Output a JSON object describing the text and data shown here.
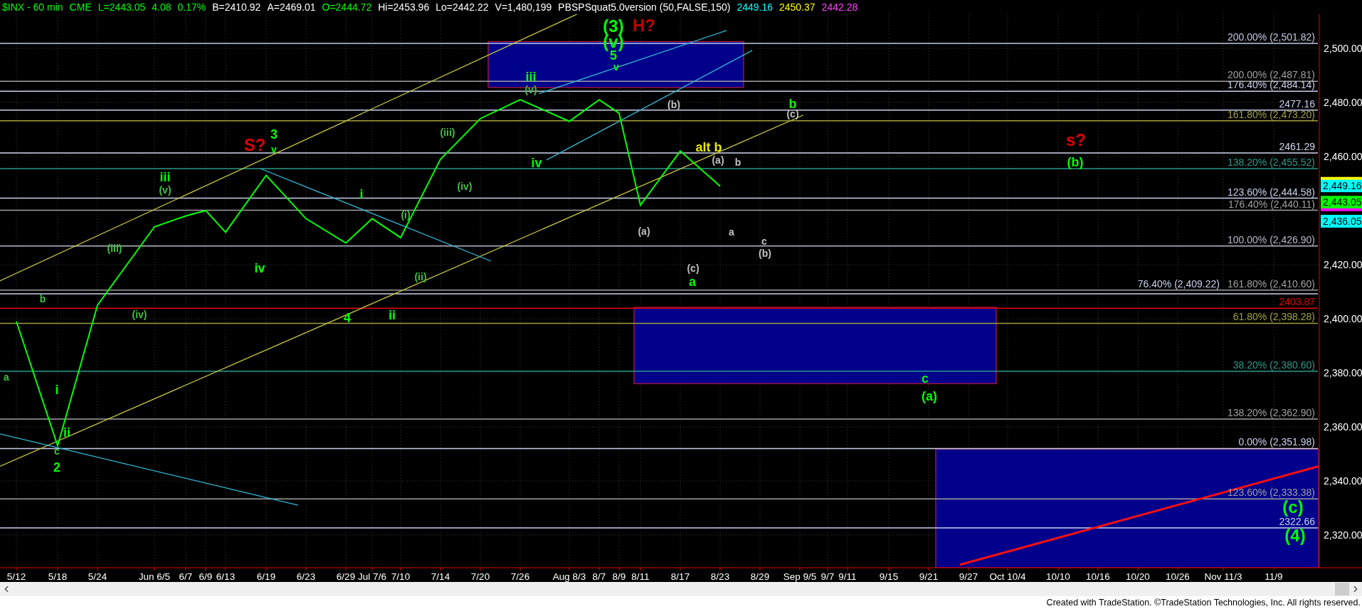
{
  "header": [
    {
      "text": "$INX - 60 min",
      "color": "#00ff00"
    },
    {
      "text": "CME",
      "color": "#00ff00"
    },
    {
      "text": "L=2443.05",
      "color": "#00ff00"
    },
    {
      "text": "4.08",
      "color": "#00ff00"
    },
    {
      "text": "0.17%",
      "color": "#00ff00"
    },
    {
      "text": "B=2410.92",
      "color": "#ffffff"
    },
    {
      "text": "A=2469.01",
      "color": "#ffffff"
    },
    {
      "text": "O=2444.72",
      "color": "#00ff00"
    },
    {
      "text": "Hi=2453.96",
      "color": "#ffffff"
    },
    {
      "text": "Lo=2442.22",
      "color": "#ffffff"
    },
    {
      "text": "V=1,480,199",
      "color": "#ffffff"
    },
    {
      "text": "PBSPSquat5.0version (50,FALSE,150)",
      "color": "#ffffff"
    },
    {
      "text": "2449.16",
      "color": "#00ffff"
    },
    {
      "text": "2450.37",
      "color": "#ffff00"
    },
    {
      "text": "2442.28",
      "color": "#ff40ff"
    }
  ],
  "chart": {
    "chart_data": {
      "type": "line",
      "categories": [
        "5/12",
        "5/18",
        "5/24",
        "Jun 6/5",
        "6/7",
        "6/9",
        "6/13",
        "6/19",
        "6/23",
        "6/29",
        "Jul 7/6",
        "7/10",
        "7/14",
        "7/20",
        "7/26",
        "Aug 8/3",
        "8/7",
        "8/9",
        "8/11",
        "8/17",
        "8/23",
        "8/29",
        "Sep 9/5",
        "9/7",
        "9/11",
        "9/15",
        "9/21",
        "9/27",
        "Oct 10/4",
        "10/10",
        "10/16",
        "10/20",
        "10/26",
        "Nov 11/3",
        "11/9"
      ],
      "series": [
        {
          "color": "#00ff00",
          "values": [
            2399,
            2353,
            2405,
            2434,
            2438,
            2440,
            2432,
            2453,
            2437,
            2428,
            2437,
            2430,
            2459,
            2474,
            2481,
            2473,
            2481,
            2476,
            2442,
            2462,
            2449,
            null,
            null,
            null,
            null,
            null,
            null,
            null,
            null,
            null,
            null,
            null,
            null,
            null,
            null
          ]
        }
      ],
      "ylim": [
        2307.9,
        2512.6
      ],
      "grid": true,
      "yticks": [
        {
          "value": 2500,
          "label": "2,500.00"
        },
        {
          "value": 2480,
          "label": "2,480.00"
        },
        {
          "value": 2460,
          "label": "2,460.00"
        },
        {
          "value": 2420,
          "label": "2,420.00"
        },
        {
          "value": 2400,
          "label": "2,400.00"
        },
        {
          "value": 2380,
          "label": "2,380.00"
        },
        {
          "value": 2360,
          "label": "2,360.00"
        },
        {
          "value": 2340,
          "label": "2,340.00"
        },
        {
          "value": 2320,
          "label": "2,320.00"
        }
      ]
    },
    "levels": [
      {
        "label": "200.00% (2,501.82)",
        "color": "#c0cae6"
      },
      {
        "label": "200.00% (2,487.81)",
        "color": "#a0a0a0"
      },
      {
        "label": "176.40% (2,484.14)",
        "color": "#c8d0ec"
      },
      {
        "label": "2477.16",
        "color": "#c8d0ec"
      },
      {
        "label": "161.80% (2,473.20)",
        "color": "#a0a040"
      },
      {
        "label": "2461.29",
        "color": "#d0d8f0"
      },
      {
        "label": "138.20% (2,455.52)",
        "color": "#2a9a86"
      },
      {
        "label": "123.60% (2,444.58)",
        "color": "#c8d0ec"
      },
      {
        "label": "176.40% (2,440.11)",
        "color": "#a0a0a0"
      },
      {
        "label": "100.00% (2,426.90)",
        "color": "#b8b8c8"
      },
      {
        "label": "76.40% (2,409.22)",
        "color": "#c8d0ec"
      },
      {
        "label": "161.80% (2,410.60)",
        "color": "#a0a0a0"
      },
      {
        "label": "2403.87",
        "color": "#e00000"
      },
      {
        "label": "61.80% (2,398.28)",
        "color": "#a0a040"
      },
      {
        "label": "38.20% (2,380.60)",
        "color": "#2a9a86"
      },
      {
        "label": "138.20% (2,362.90)",
        "color": "#a0a0a0"
      },
      {
        "label": "0.00% (2,351.98)",
        "color": "#c8d0ec"
      },
      {
        "label": "123.60% (2,333.38)",
        "color": "#a0a0a0"
      },
      {
        "label": "2322.66",
        "color": "#c8d0ec"
      }
    ],
    "wave_labels": [
      {
        "text": "(3)",
        "color": "#00ff00"
      },
      {
        "text": "(v)",
        "color": "#00ff00"
      },
      {
        "text": "H?",
        "color": "#c00000"
      },
      {
        "text": "5",
        "color": "#00ff00"
      },
      {
        "text": "v",
        "color": "#00ff00"
      },
      {
        "text": "iii",
        "color": "#00ff00"
      },
      {
        "text": "(v)",
        "color": "#40c040"
      },
      {
        "text": "(b)",
        "color": "#c0c0c0"
      },
      {
        "text": "b",
        "color": "#00ff00"
      },
      {
        "text": "(c)",
        "color": "#c0c0c0"
      },
      {
        "text": "s?",
        "color": "#e00000"
      },
      {
        "text": "(b)",
        "color": "#00ff00"
      },
      {
        "text": "S?",
        "color": "#e00000"
      },
      {
        "text": "3",
        "color": "#00ff00"
      },
      {
        "text": "v",
        "color": "#00ff00"
      },
      {
        "text": "iii",
        "color": "#00ff00"
      },
      {
        "text": "(v)",
        "color": "#40c040"
      },
      {
        "text": "(iii)",
        "color": "#40c040"
      },
      {
        "text": "iv",
        "color": "#00ff00"
      },
      {
        "text": "(iv)",
        "color": "#40c040"
      },
      {
        "text": "alt b",
        "color": "#e8e800"
      },
      {
        "text": "(a)",
        "color": "#c0c0c0"
      },
      {
        "text": "b",
        "color": "#c0c0c0"
      },
      {
        "text": "i",
        "color": "#00ff00"
      },
      {
        "text": "(i)",
        "color": "#40c040"
      },
      {
        "text": "(iii)",
        "color": "#40c040"
      },
      {
        "text": "iv",
        "color": "#00ff00"
      },
      {
        "text": "(a)",
        "color": "#c0c0c0"
      },
      {
        "text": "a",
        "color": "#c0c0c0"
      },
      {
        "text": "c",
        "color": "#c0c0c0"
      },
      {
        "text": "(b)",
        "color": "#c0c0c0"
      },
      {
        "text": "(ii)",
        "color": "#40c040"
      },
      {
        "text": "(c)",
        "color": "#c0c0c0"
      },
      {
        "text": "a",
        "color": "#00ff00"
      },
      {
        "text": "b",
        "color": "#40c040"
      },
      {
        "text": "(iv)",
        "color": "#40c040"
      },
      {
        "text": "4",
        "color": "#00ff00"
      },
      {
        "text": "ii",
        "color": "#00ff00"
      },
      {
        "text": "a",
        "color": "#40c040"
      },
      {
        "text": "i",
        "color": "#00ff00"
      },
      {
        "text": "ii",
        "color": "#00ff00"
      },
      {
        "text": "c",
        "color": "#40c040"
      },
      {
        "text": "2",
        "color": "#00ff00"
      },
      {
        "text": "c",
        "color": "#00ff00"
      },
      {
        "text": "(a)",
        "color": "#00ff00"
      },
      {
        "text": "(c)",
        "color": "#00ff00"
      },
      {
        "text": "(4)",
        "color": "#00ff00"
      }
    ],
    "price_tags": [
      {
        "color": "#ffff00"
      },
      {
        "text": "2,449.16",
        "color": "#00ffff"
      },
      {
        "color": "#ff00ff"
      },
      {
        "text": "2,443.05",
        "color": "#00ff00"
      },
      {
        "text": "2,436.05",
        "color": "#00ffff"
      }
    ]
  },
  "footer": "Created with TradeStation. ©TradeStation Technologies, Inc. All rights reserved."
}
